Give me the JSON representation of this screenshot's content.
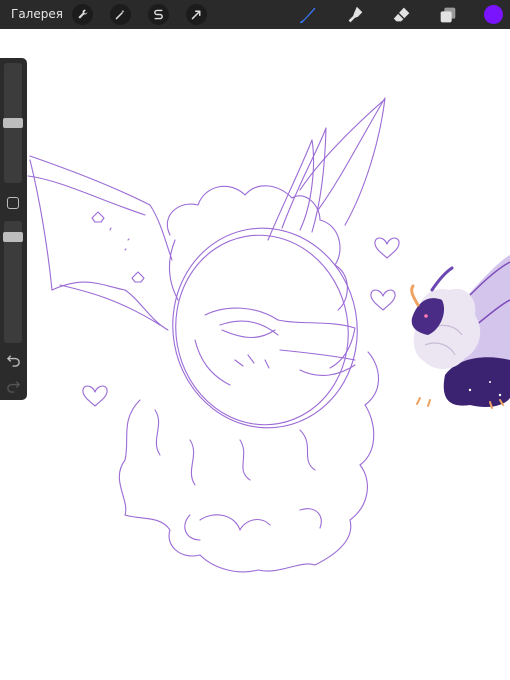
{
  "toolbar": {
    "gallery_label": "Галерея",
    "left_tools": [
      "wrench-icon",
      "magic-wand-icon",
      "selection-icon",
      "transform-arrow-icon"
    ],
    "right_tools": [
      "brush-icon",
      "smudge-icon",
      "eraser-icon",
      "layers-icon"
    ],
    "active_tool": "brush-icon",
    "accent": "#3a7bff",
    "current_color": "#7a14ff"
  },
  "sidebar": {
    "brush_size_level": 0.5,
    "opacity_level": 0.1,
    "buttons": [
      "modifier-button",
      "undo-icon",
      "redo-icon"
    ]
  },
  "canvas": {
    "sketch_color": "#9b6bd6",
    "background": "#ffffff"
  }
}
